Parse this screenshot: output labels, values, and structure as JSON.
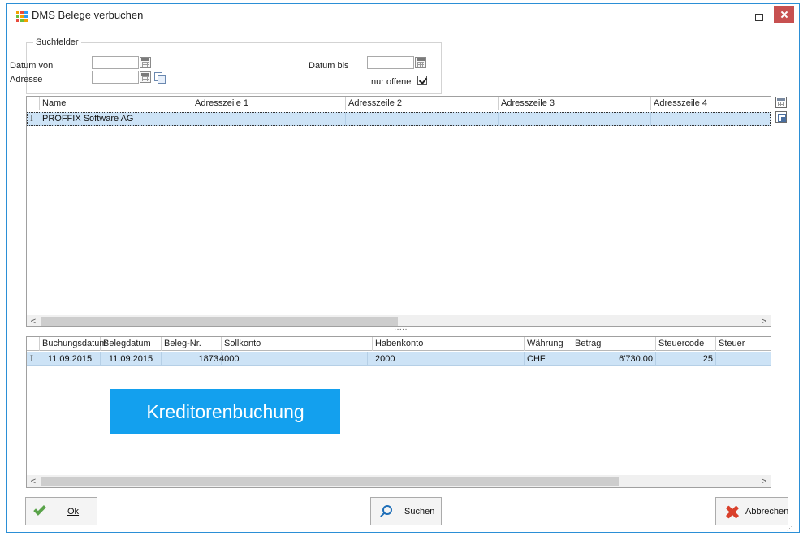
{
  "window": {
    "title": "DMS Belege verbuchen",
    "icon": "app-grid-icon",
    "app_icon_colors": [
      "#f2a000",
      "#e84c3d",
      "#2a9df4",
      "#6bbf3b",
      "#f2a000",
      "#2a9df4",
      "#e84c3d",
      "#6bbf3b",
      "#f2a000"
    ]
  },
  "search": {
    "legend": "Suchfelder",
    "date_from_label": "Datum von",
    "date_from_value": "",
    "date_to_label": "Datum bis",
    "date_to_value": "",
    "address_label": "Adresse",
    "address_value": "",
    "only_open_label": "nur offene",
    "only_open_checked": true
  },
  "address_grid": {
    "columns": [
      "Name",
      "Adresszeile 1",
      "Adresszeile 2",
      "Adresszeile 3",
      "Adresszeile 4"
    ],
    "rows": [
      [
        "PROFFIX Software AG",
        "",
        "",
        "",
        ""
      ]
    ]
  },
  "booking_grid": {
    "columns": [
      "Buchungsdatum",
      "Belegdatum",
      "Beleg-Nr.",
      "Sollkonto",
      "Habenkonto",
      "Währung",
      "Betrag",
      "Steuercode",
      "Steuer"
    ],
    "rows": [
      [
        "11.09.2015",
        "11.09.2015",
        "1873",
        "4000",
        "2000",
        "CHF",
        "6'730.00",
        "25",
        ""
      ]
    ]
  },
  "splitter": "·····",
  "banner": {
    "text": "Kreditorenbuchung",
    "color": "#13a0ee"
  },
  "buttons": {
    "ok": "Ok",
    "search": "Suchen",
    "cancel": "Abbrechen"
  },
  "scroll_arrows": {
    "left": "<",
    "right": ">"
  },
  "colors": {
    "accent": "#2b8fd6",
    "close": "#c75050",
    "selected_row": "#cde3f6",
    "ok_icon": "#5aa34a",
    "cancel_icon": "#d9402b"
  }
}
